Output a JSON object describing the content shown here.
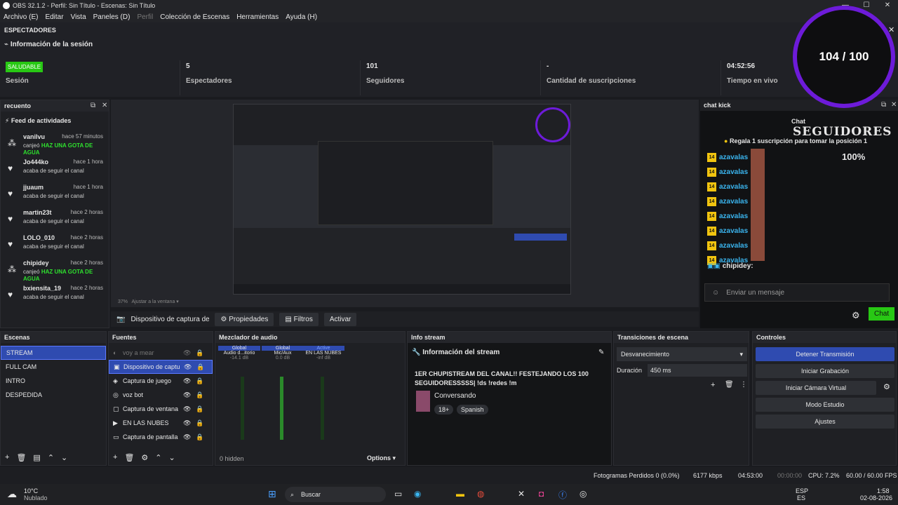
{
  "title": "OBS 32.1.2 - Perfil: Sin Título - Escenas: Sin Título",
  "menu": [
    "Archivo (E)",
    "Editar",
    "Vista",
    "Paneles (D)",
    "Perfil",
    "Colección de Escenas",
    "Herramientas",
    "Ayuda (H)"
  ],
  "viewers": {
    "header": "ESPECTADORES",
    "session_title": "Información de la sesión",
    "live_badge": "SALUDABLE",
    "stats": [
      {
        "value": "",
        "label": "Sesión"
      },
      {
        "value": "5",
        "label": "Espectadores"
      },
      {
        "value": "101",
        "label": "Seguidores"
      },
      {
        "value": "-",
        "label": "Cantidad de suscripciones"
      },
      {
        "value": "04:52:56",
        "label": "Tiempo en vivo"
      }
    ]
  },
  "goal": {
    "text": "104 / 100"
  },
  "recuento": {
    "title": "recuento",
    "feed_title": "Feed de actividades",
    "items": [
      {
        "user": "vanilvu",
        "time": "hace 57 minutos",
        "action": "canjeó",
        "highlight": "HAZ UNA GOTA DE AGUA",
        "icon": "drops-icon"
      },
      {
        "user": "Jo444ko",
        "time": "hace 1 hora",
        "action": "acaba de seguir el canal",
        "highlight": "",
        "icon": "heart-icon"
      },
      {
        "user": "jjuaum",
        "time": "hace 1 hora",
        "action": "acaba de seguir el canal",
        "highlight": "",
        "icon": "heart-icon"
      },
      {
        "user": "martin23t",
        "time": "hace 2 horas",
        "action": "acaba de seguir el canal",
        "highlight": "",
        "icon": "heart-icon"
      },
      {
        "user": "LOLO_010",
        "time": "hace 2 horas",
        "action": "acaba de seguir el canal",
        "highlight": "",
        "icon": "heart-icon"
      },
      {
        "user": "chipidey",
        "time": "hace 2 horas",
        "action": "canjeó",
        "highlight": "HAZ UNA GOTA DE AGUA",
        "icon": "drops-icon"
      },
      {
        "user": "bxiensita_19",
        "time": "hace 2 horas",
        "action": "acaba de seguir el canal",
        "highlight": "",
        "icon": "heart-icon"
      }
    ]
  },
  "preview": {
    "zoom": "37%",
    "zoom_label": "Ajustar a la ventana"
  },
  "source_bar": {
    "source": "Dispositivo de captura de v",
    "props": "Propiedades",
    "filters": "Filtros",
    "activate": "Activar"
  },
  "chat": {
    "title": "chat kick",
    "overlay_title": "Chat",
    "followers_label": "SEGUIDORES",
    "percent": "100%",
    "pin": "Regala 1 suscripción para tomar la posición 1",
    "rows": [
      "azavalas",
      "azavalas",
      "azavalas",
      "azavalas",
      "azavalas",
      "azavalas",
      "azavalas",
      "azavalas"
    ],
    "badge": "14",
    "last_user": "chipidey:",
    "placeholder": "Enviar un mensaje",
    "send": "Chat"
  },
  "scenes": {
    "title": "Escenas",
    "items": [
      "STREAM",
      "FULL CAM",
      "INTRO",
      "DESPEDIDA"
    ]
  },
  "sources": {
    "title": "Fuentes",
    "items": [
      "voy a mear",
      "Dispositivo de captu",
      "Captura de juego",
      "voz bot",
      "Captura de ventana",
      "EN LAS NUBES",
      "Captura de pantalla"
    ]
  },
  "mixer": {
    "title": "Mezclador de audio",
    "cols": [
      {
        "tag": "Global",
        "name": "Audio d...itorio",
        "db": "-14.1 dB"
      },
      {
        "tag": "Global",
        "name": "Mic/Aux",
        "db": "0.0 dB"
      },
      {
        "tag": "Active",
        "name": "EN LAS NUBES",
        "db": "-inf dB"
      }
    ],
    "hidden": "0 hidden",
    "options": "Options"
  },
  "info": {
    "title": "Info stream",
    "heading": "Información del stream",
    "stream_title": "1ER CHUPISTREAM DEL CANAL!! FESTEJANDO LOS 100 SEGUIDORESSSSS| !ds !redes !m",
    "category": "Conversando",
    "tag1": "18+",
    "tag2": "Spanish"
  },
  "transitions": {
    "title": "Transiciones de escena",
    "selected": "Desvanecimiento",
    "dur_label": "Duración",
    "dur": "450 ms"
  },
  "controls": {
    "title": "Controles",
    "buttons": [
      "Detener Transmisión",
      "Iniciar Grabación",
      "Iniciar Cámara Virtual",
      "Modo Estudio",
      "Ajustes"
    ]
  },
  "status": {
    "frames": "Fotogramas Perdidos 0 (0.0%)",
    "kbps": "6177 kbps",
    "live": "04:53:00",
    "rec": "00:00:00",
    "cpu": "CPU: 7.2%",
    "fps": "60.00 / 60.00 FPS"
  },
  "taskbar": {
    "temp": "10°C",
    "weather": "Nublado",
    "search": "Buscar",
    "lang1": "ESP",
    "lang2": "ES",
    "time": "1:58",
    "date": "02-08-2026"
  }
}
